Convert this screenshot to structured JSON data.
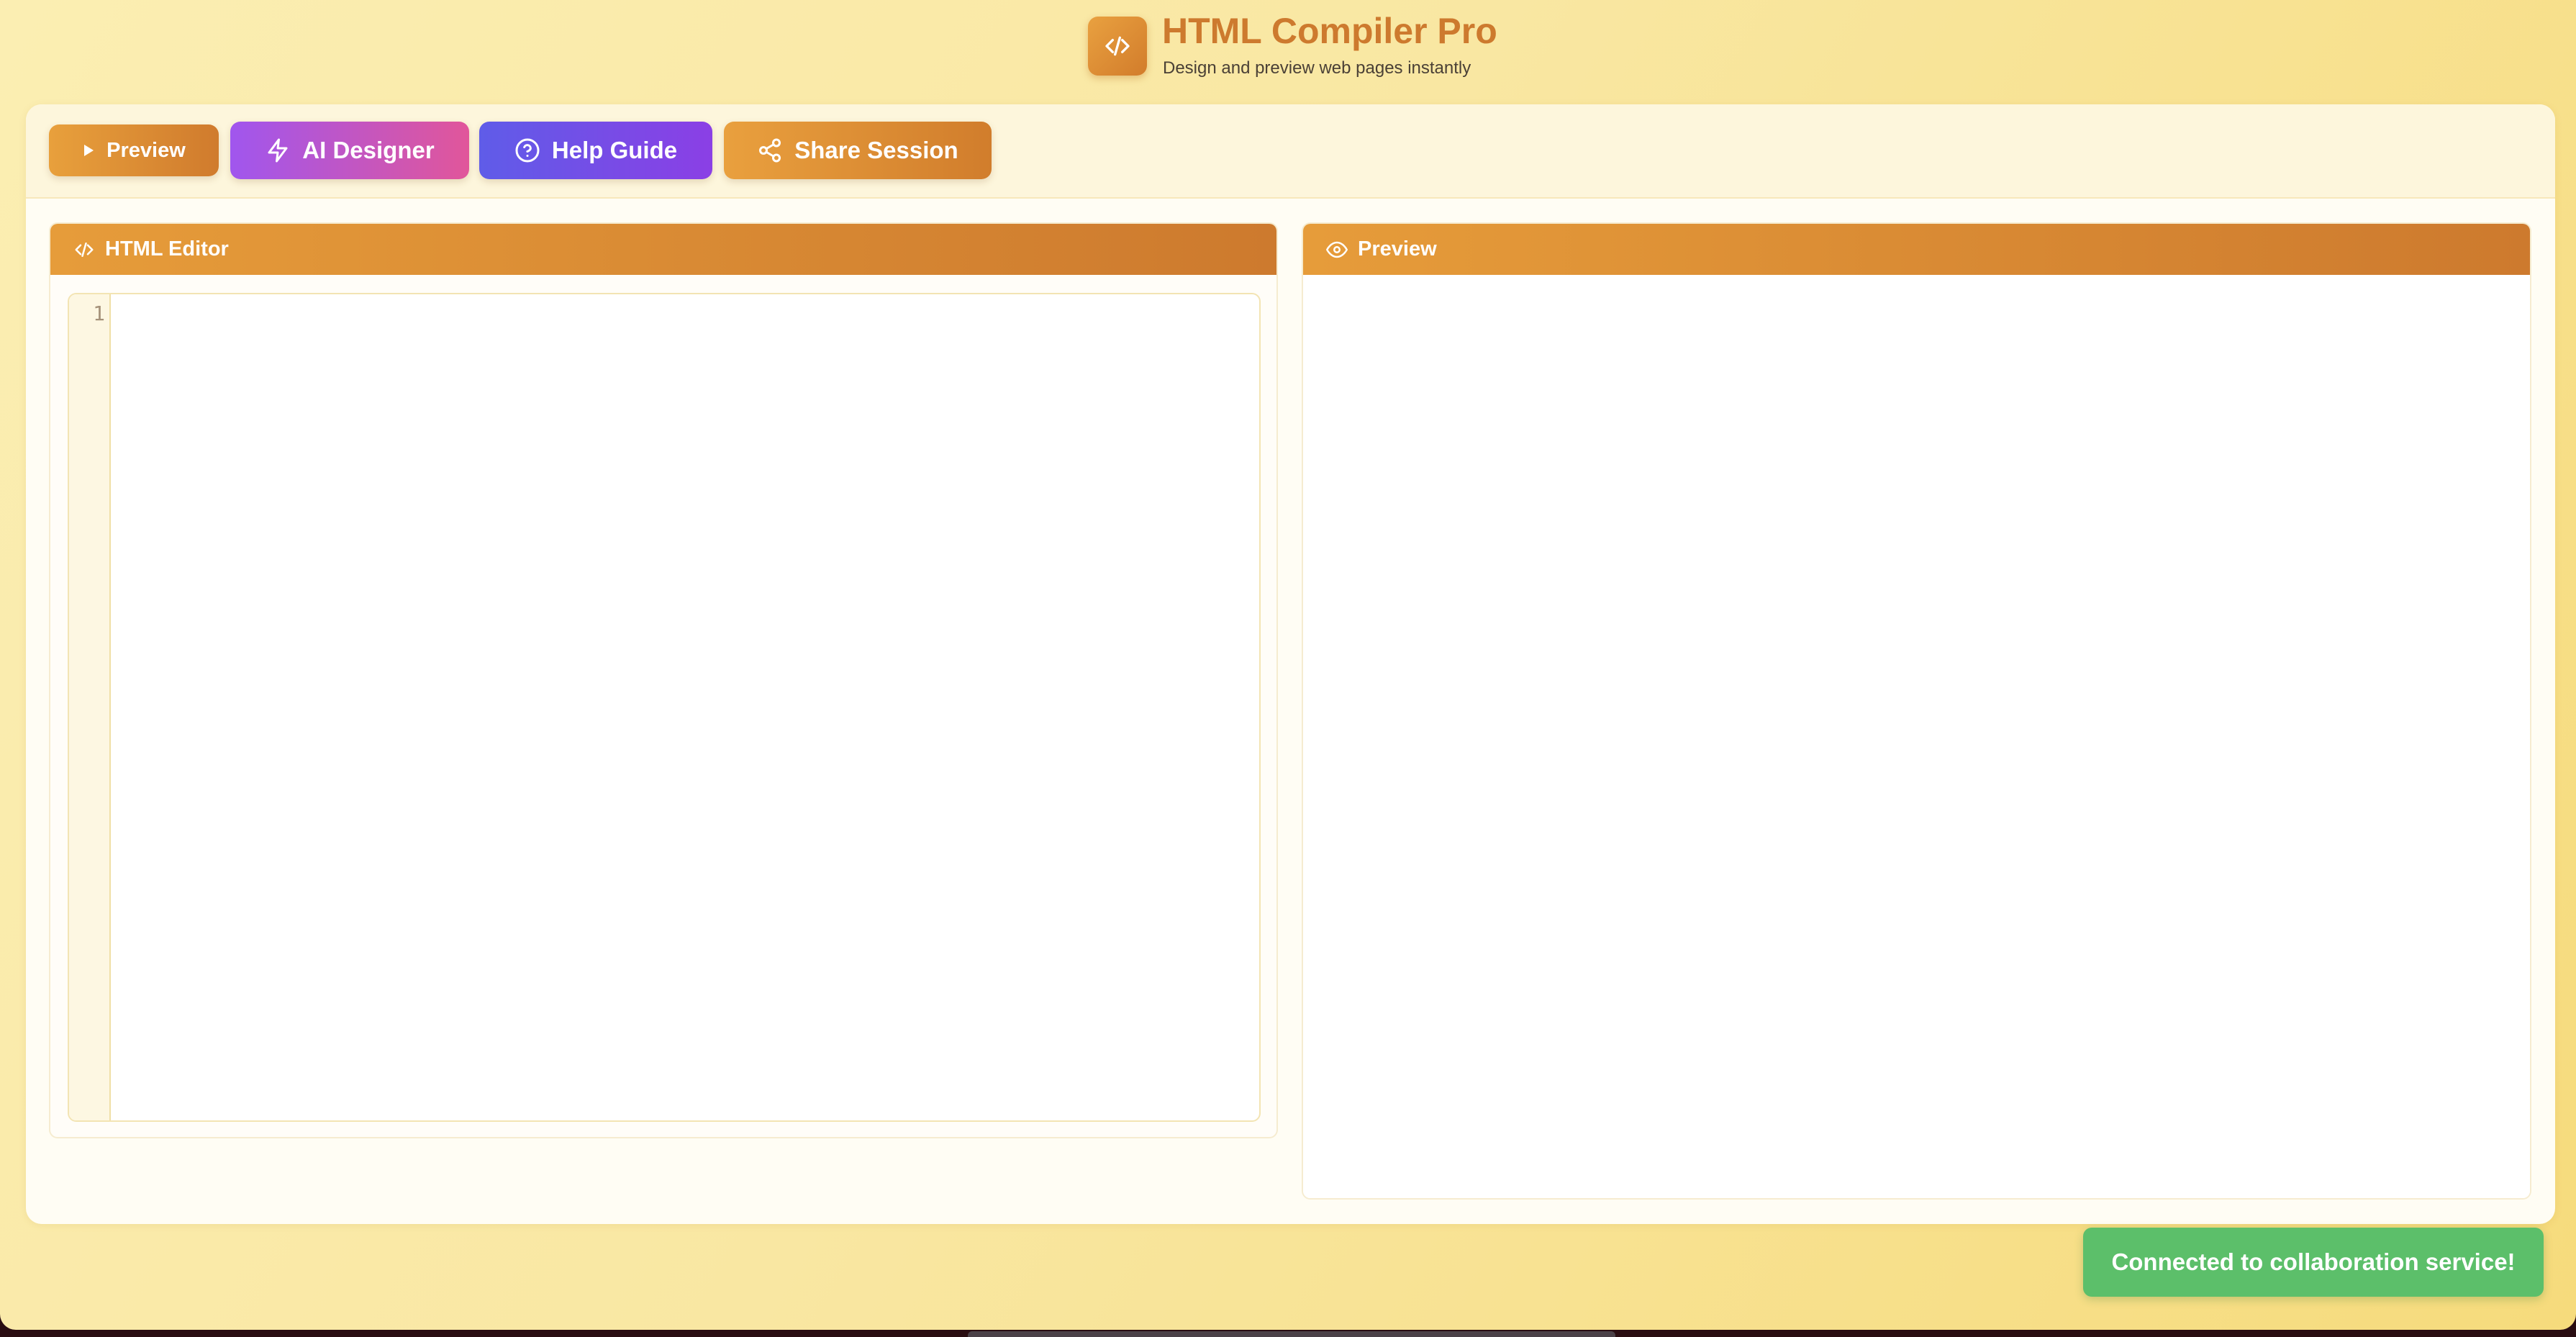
{
  "app": {
    "title": "HTML Compiler Pro",
    "subtitle": "Design and preview web pages instantly",
    "logo_icon": "code-icon"
  },
  "toolbar": {
    "preview_label": "Preview",
    "ai_designer_label": "AI Designer",
    "help_guide_label": "Help Guide",
    "share_session_label": "Share Session"
  },
  "editor": {
    "title": "HTML Editor",
    "line_numbers": [
      "1"
    ],
    "content": ""
  },
  "preview_panel": {
    "title": "Preview"
  },
  "toast": {
    "message": "Connected to collaboration service!"
  },
  "colors": {
    "accent": "#cd7a2e",
    "accent_light": "#e8a03c",
    "ai_gradient_start": "#a056ee",
    "ai_gradient_end": "#e1569a",
    "help_gradient_start": "#5f5ce8",
    "help_gradient_end": "#8b3fe5",
    "toast_success": "#5cbf6a",
    "background": "#f9e7a2"
  }
}
